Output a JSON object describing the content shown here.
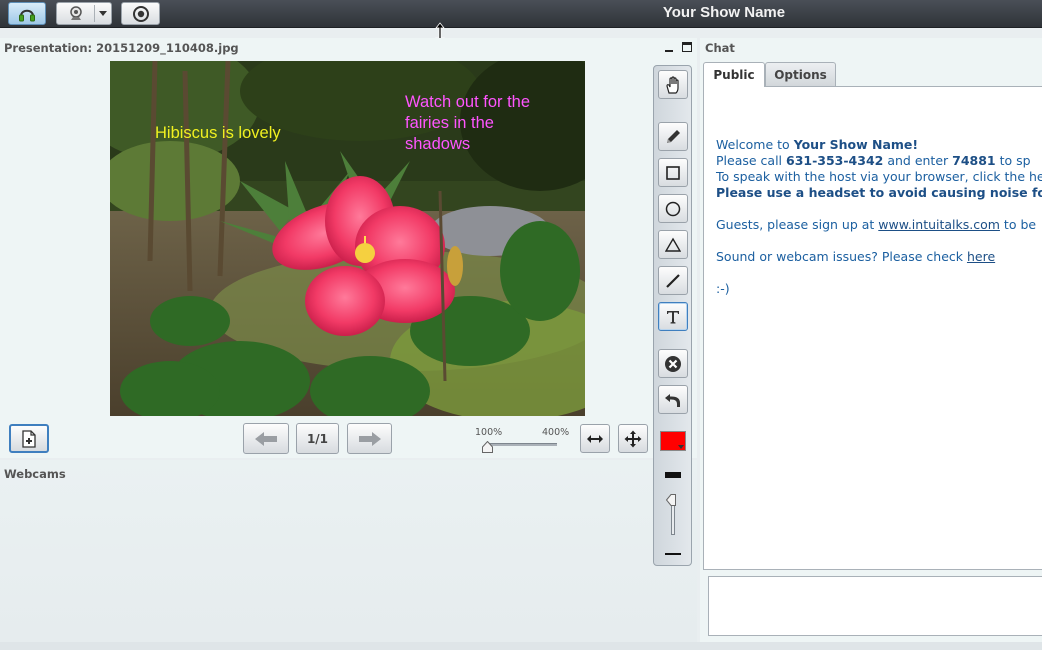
{
  "topbar": {
    "show_title": "Your Show Name",
    "buttons": [
      {
        "name": "headset-button",
        "icon": "headset-icon",
        "active": true
      },
      {
        "name": "webcam-button",
        "icon": "webcam-icon",
        "has_dropdown": true
      },
      {
        "name": "record-button",
        "icon": "record-icon"
      }
    ]
  },
  "presentation": {
    "title": "Presentation: 20151209_110408.jpg",
    "annotations": [
      {
        "text": "Hibiscus is lovely",
        "color": "#f0f020"
      },
      {
        "text": "Watch out for the fairies in the shadows",
        "color": "#ff55ff"
      }
    ],
    "page_indicator": "1/1",
    "zoom": {
      "min_label": "100%",
      "max_label": "400%",
      "value_percent": 100
    }
  },
  "webcams": {
    "title": "Webcams"
  },
  "whiteboard": {
    "tools": [
      "hand-icon",
      "pencil-icon",
      "rectangle-icon",
      "ellipse-icon",
      "triangle-icon",
      "line-icon",
      "text-icon",
      "clear-icon",
      "undo-icon"
    ],
    "active_tool": "text-icon",
    "color": "#ff0000"
  },
  "chat": {
    "title": "Chat",
    "tabs": [
      "Public",
      "Options"
    ],
    "active_tab": "Public",
    "welcome_prefix": "Welcome to ",
    "welcome_name": "Your Show Name!",
    "call_prefix": " Please call ",
    "phone": "631-353-4342",
    "call_middle": " and enter ",
    "pin": "74881",
    "call_suffix": " to sp",
    "browser_line": "To speak with the host via your browser, click the he",
    "headset_line": "Please use a headset to avoid causing noise for ot",
    "guests_prefix": "Guests, please sign up at ",
    "guests_link": "www.intuitalks.com",
    "guests_suffix": " to be",
    "issues_prefix": "Sound or webcam issues? Please check ",
    "issues_link": "here",
    "smiley": ":-)"
  }
}
